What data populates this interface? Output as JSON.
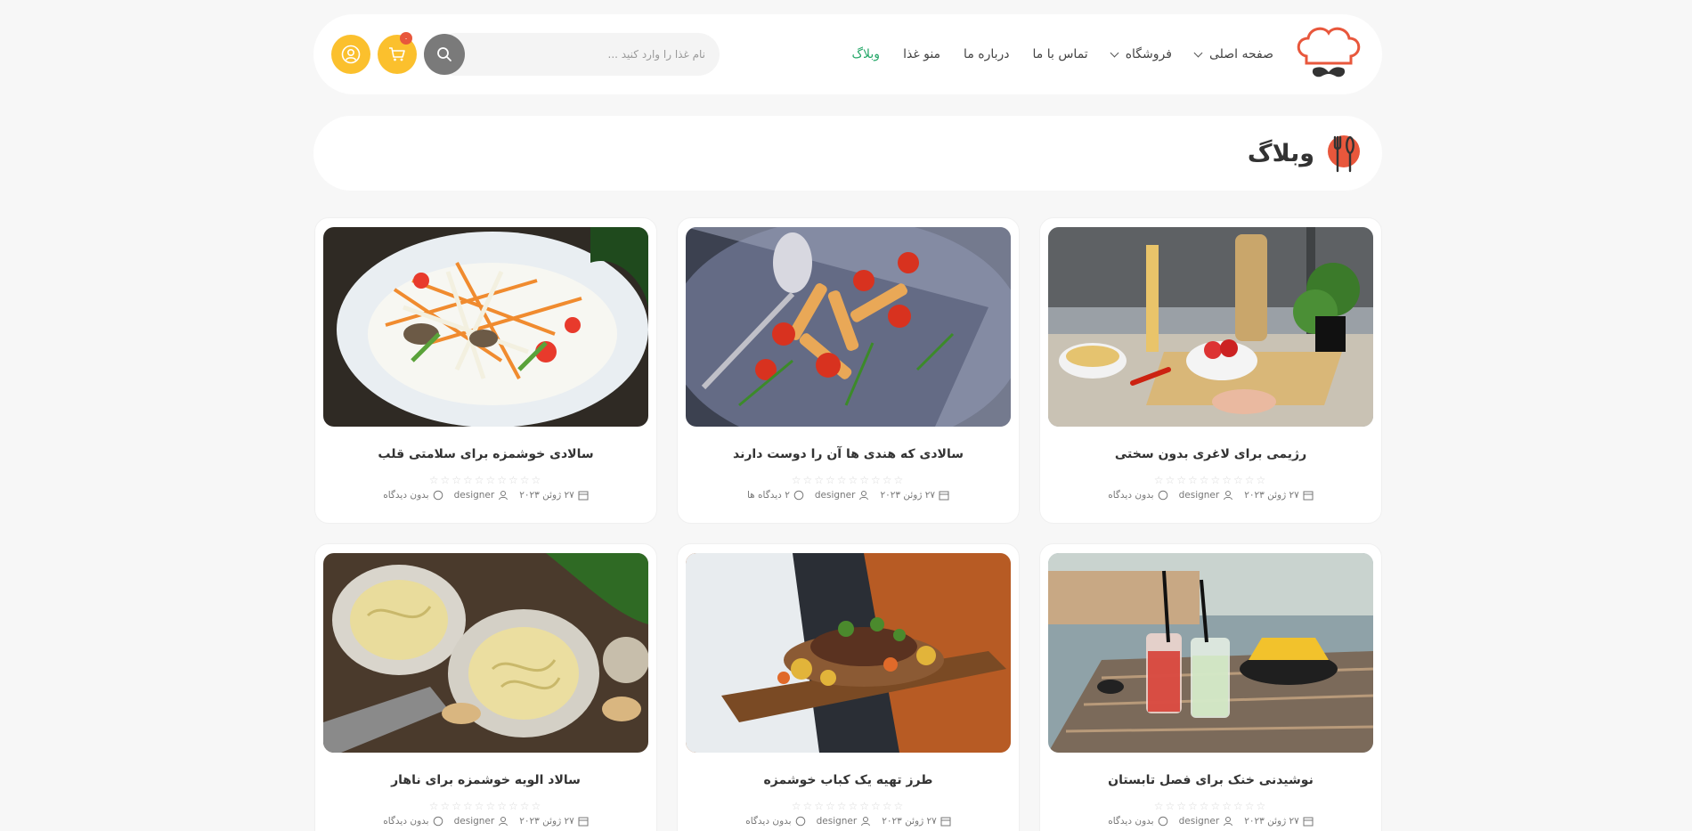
{
  "header": {
    "nav": [
      {
        "label": "صفحه اصلی",
        "dropdown": true,
        "active": false
      },
      {
        "label": "فروشگاه",
        "dropdown": true,
        "active": false
      },
      {
        "label": "تماس با ما",
        "dropdown": false,
        "active": false
      },
      {
        "label": "درباره ما",
        "dropdown": false,
        "active": false
      },
      {
        "label": "منو غذا",
        "dropdown": false,
        "active": false
      },
      {
        "label": "وبلاگ",
        "dropdown": false,
        "active": true
      }
    ],
    "search_placeholder": "نام غذا را وارد کنید ...",
    "cart_count": "۰"
  },
  "page": {
    "title": "وبلاگ"
  },
  "posts": [
    {
      "title": "رژیمی برای لاغری بدون سختی",
      "date": "۲۷ ژوئن ۲۰۲۳",
      "author": "designer",
      "comments": "بدون دیدگاه",
      "image": "kitchen-ingredients"
    },
    {
      "title": "سالادی که هندی ها آن را دوست دارند",
      "date": "۲۷ ژوئن ۲۰۲۳",
      "author": "designer",
      "comments": "۲ دیدگاه ها",
      "image": "pasta-tomato-salad"
    },
    {
      "title": "سالادی خوشمزه برای سلامتی قلب",
      "date": "۲۷ ژوئن ۲۰۲۳",
      "author": "designer",
      "comments": "بدون دیدگاه",
      "image": "papaya-salad"
    },
    {
      "title": "نوشیدنی خنک برای فصل تابستان",
      "date": "۲۷ ژوئن ۲۰۲۳",
      "author": "designer",
      "comments": "بدون دیدگاه",
      "image": "summer-drinks"
    },
    {
      "title": "طرز تهیه یک کباب خوشمزه",
      "date": "۲۷ ژوئن ۲۰۲۳",
      "author": "designer",
      "comments": "بدون دیدگاه",
      "image": "kebab-board"
    },
    {
      "title": "سالاد الویه خوشمزه برای ناهار",
      "date": "۲۷ ژوئن ۲۰۲۳",
      "author": "designer",
      "comments": "بدون دیدگاه",
      "image": "pasta-plates"
    }
  ],
  "colors": {
    "accent": "#fbc02d",
    "active_nav": "#27a86a",
    "search_button": "#7a7a7a",
    "badge": "#e8573c"
  }
}
